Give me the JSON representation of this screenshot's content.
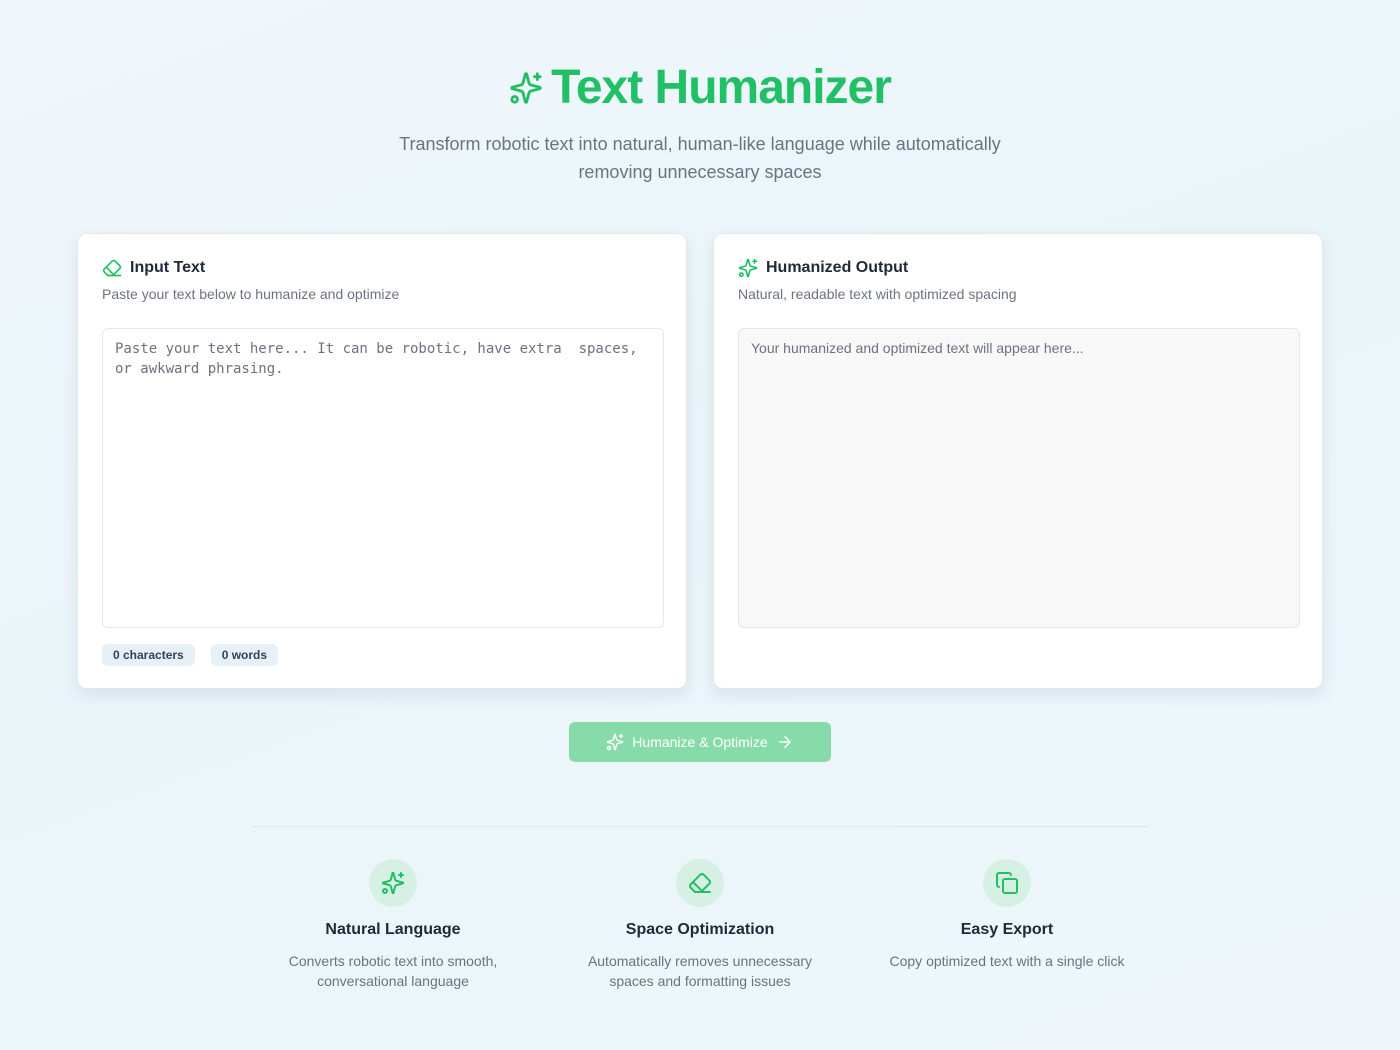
{
  "header": {
    "title": "Text Humanizer",
    "title_icon": "sparkles-icon",
    "subtitle": "Transform robotic text into natural, human-like language while automatically removing unnecessary spaces"
  },
  "input_card": {
    "icon": "eraser-icon",
    "title": "Input Text",
    "description": "Paste your text below to humanize and optimize",
    "value": "",
    "placeholder": "Paste your text here... It can be robotic, have extra  spaces, or awkward phrasing.",
    "chars": "0 characters",
    "words": "0 words"
  },
  "output_card": {
    "icon": "sparkles-icon",
    "title": "Humanized Output",
    "description": "Natural, readable text with optimized spacing",
    "placeholder": "Your humanized and optimized text will appear here..."
  },
  "action": {
    "label": "Humanize & Optimize",
    "icon": "sparkles-icon",
    "trailing_icon": "arrow-right-icon"
  },
  "features": [
    {
      "icon": "sparkles-icon",
      "title": "Natural Language",
      "description": "Converts robotic text into smooth, conversational language"
    },
    {
      "icon": "eraser-icon",
      "title": "Space Optimization",
      "description": "Automatically removes unnecessary spaces and formatting issues"
    },
    {
      "icon": "copy-icon",
      "title": "Easy Export",
      "description": "Copy optimized text with a single click"
    }
  ],
  "colors": {
    "accent": "#22c066",
    "button_bg": "#86dba8",
    "feature_icon_bg": "#d7f0e4",
    "chip_bg": "#e6f0f8"
  }
}
